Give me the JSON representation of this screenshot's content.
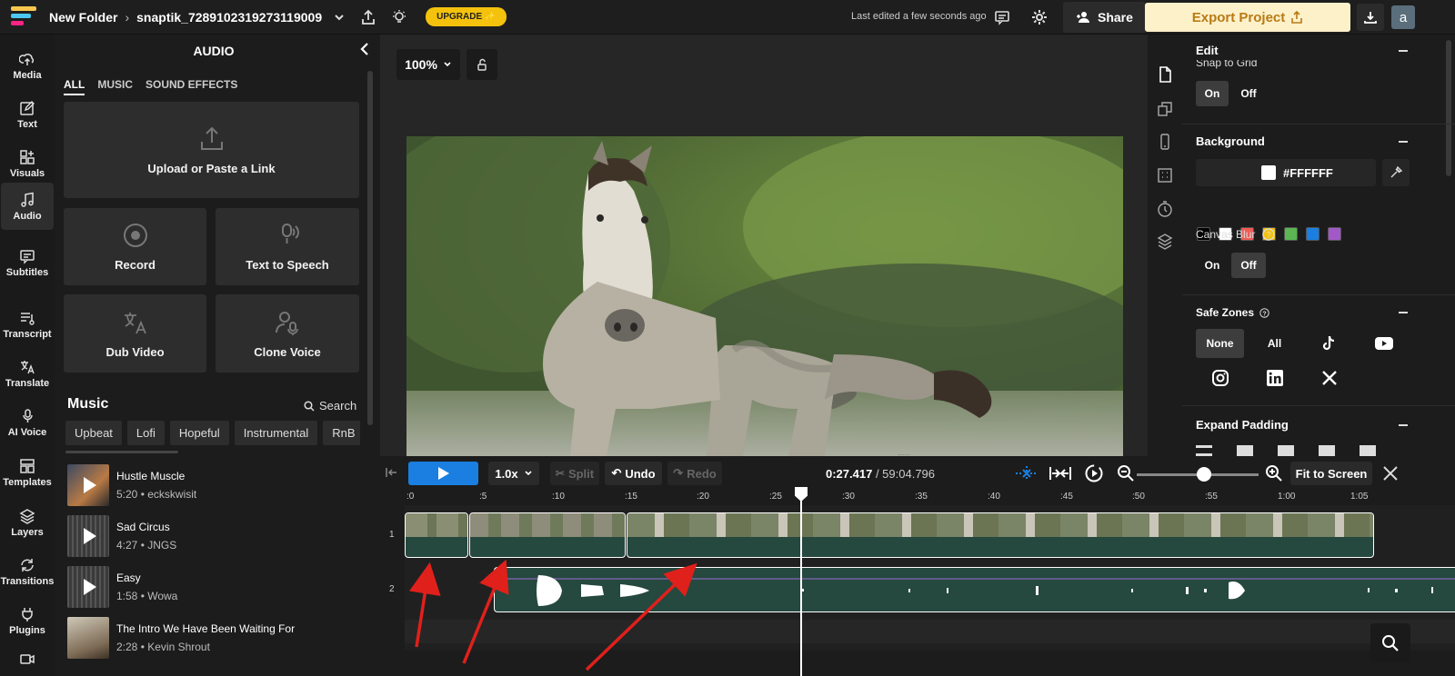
{
  "header": {
    "folder": "New Folder",
    "file_name": "snaptik_7289102319273119009",
    "upgrade_label": "UPGRADE ✨",
    "last_edited": "Last edited a few seconds ago",
    "share_label": "Share",
    "export_label": "Export Project",
    "avatar_letter": "a"
  },
  "leftnav": {
    "items": [
      {
        "label": "Media",
        "icon": "upload-cloud-icon"
      },
      {
        "label": "Text",
        "icon": "pencil-square-icon"
      },
      {
        "label": "Visuals",
        "icon": "shapes-icon"
      },
      {
        "label": "Audio",
        "icon": "music-note-icon"
      },
      {
        "label": "Subtitles",
        "icon": "subtitles-icon"
      },
      {
        "label": "Transcript",
        "icon": "transcript-icon"
      },
      {
        "label": "Translate",
        "icon": "translate-icon"
      },
      {
        "label": "AI Voice",
        "icon": "microphone-icon"
      },
      {
        "label": "Templates",
        "icon": "templates-icon"
      },
      {
        "label": "Layers",
        "icon": "layers-icon"
      },
      {
        "label": "Transitions",
        "icon": "transitions-icon"
      },
      {
        "label": "Plugins",
        "icon": "plug-icon"
      }
    ]
  },
  "audio_panel": {
    "title": "AUDIO",
    "tabs": [
      "ALL",
      "MUSIC",
      "SOUND EFFECTS"
    ],
    "upload_label": "Upload or Paste a Link",
    "record_label": "Record",
    "tts_label": "Text to Speech",
    "dub_label": "Dub Video",
    "clone_label": "Clone Voice",
    "music_heading": "Music",
    "search_label": "Search",
    "genres": [
      "Upbeat",
      "Lofi",
      "Hopeful",
      "Instrumental",
      "RnB"
    ],
    "tracks": [
      {
        "title": "Hustle Muscle",
        "meta": "5:20 • eckskwisit"
      },
      {
        "title": "Sad Circus",
        "meta": "4:27 • JNGS"
      },
      {
        "title": "Easy",
        "meta": "1:58 • Wowa"
      },
      {
        "title": "The Intro We Have Been Waiting For",
        "meta": "2:28 • Kevin Shrout"
      }
    ]
  },
  "stage": {
    "zoom": "100%"
  },
  "properties": {
    "edit_title": "Edit",
    "snap_label": "Snap to Grid",
    "on_label": "On",
    "off_label": "Off",
    "background_title": "Background",
    "bg_hex": "#FFFFFF",
    "swatches": [
      "#000000",
      "#ffffff",
      "#f25c54",
      "#f4c20d",
      "#5ab552",
      "#1a7fe0",
      "#a259c7"
    ],
    "canvas_blur_label": "Canvas Blur",
    "safe_zones_title": "Safe Zones",
    "safe_none": "None",
    "safe_all": "All",
    "expand_padding_title": "Expand Padding"
  },
  "timeline": {
    "speed": "1.0x",
    "split_label": "Split",
    "undo_label": "Undo",
    "redo_label": "Redo",
    "current_time": "0:27.417",
    "total_time": "/ 59:04.796",
    "fit_label": "Fit to Screen",
    "ticks": [
      ":0",
      ":5",
      ":10",
      ":15",
      ":20",
      ":25",
      ":30",
      ":35",
      ":40",
      ":45",
      ":50",
      ":55",
      "1:00",
      "1:05"
    ],
    "lane_labels": [
      "1",
      "2"
    ]
  }
}
